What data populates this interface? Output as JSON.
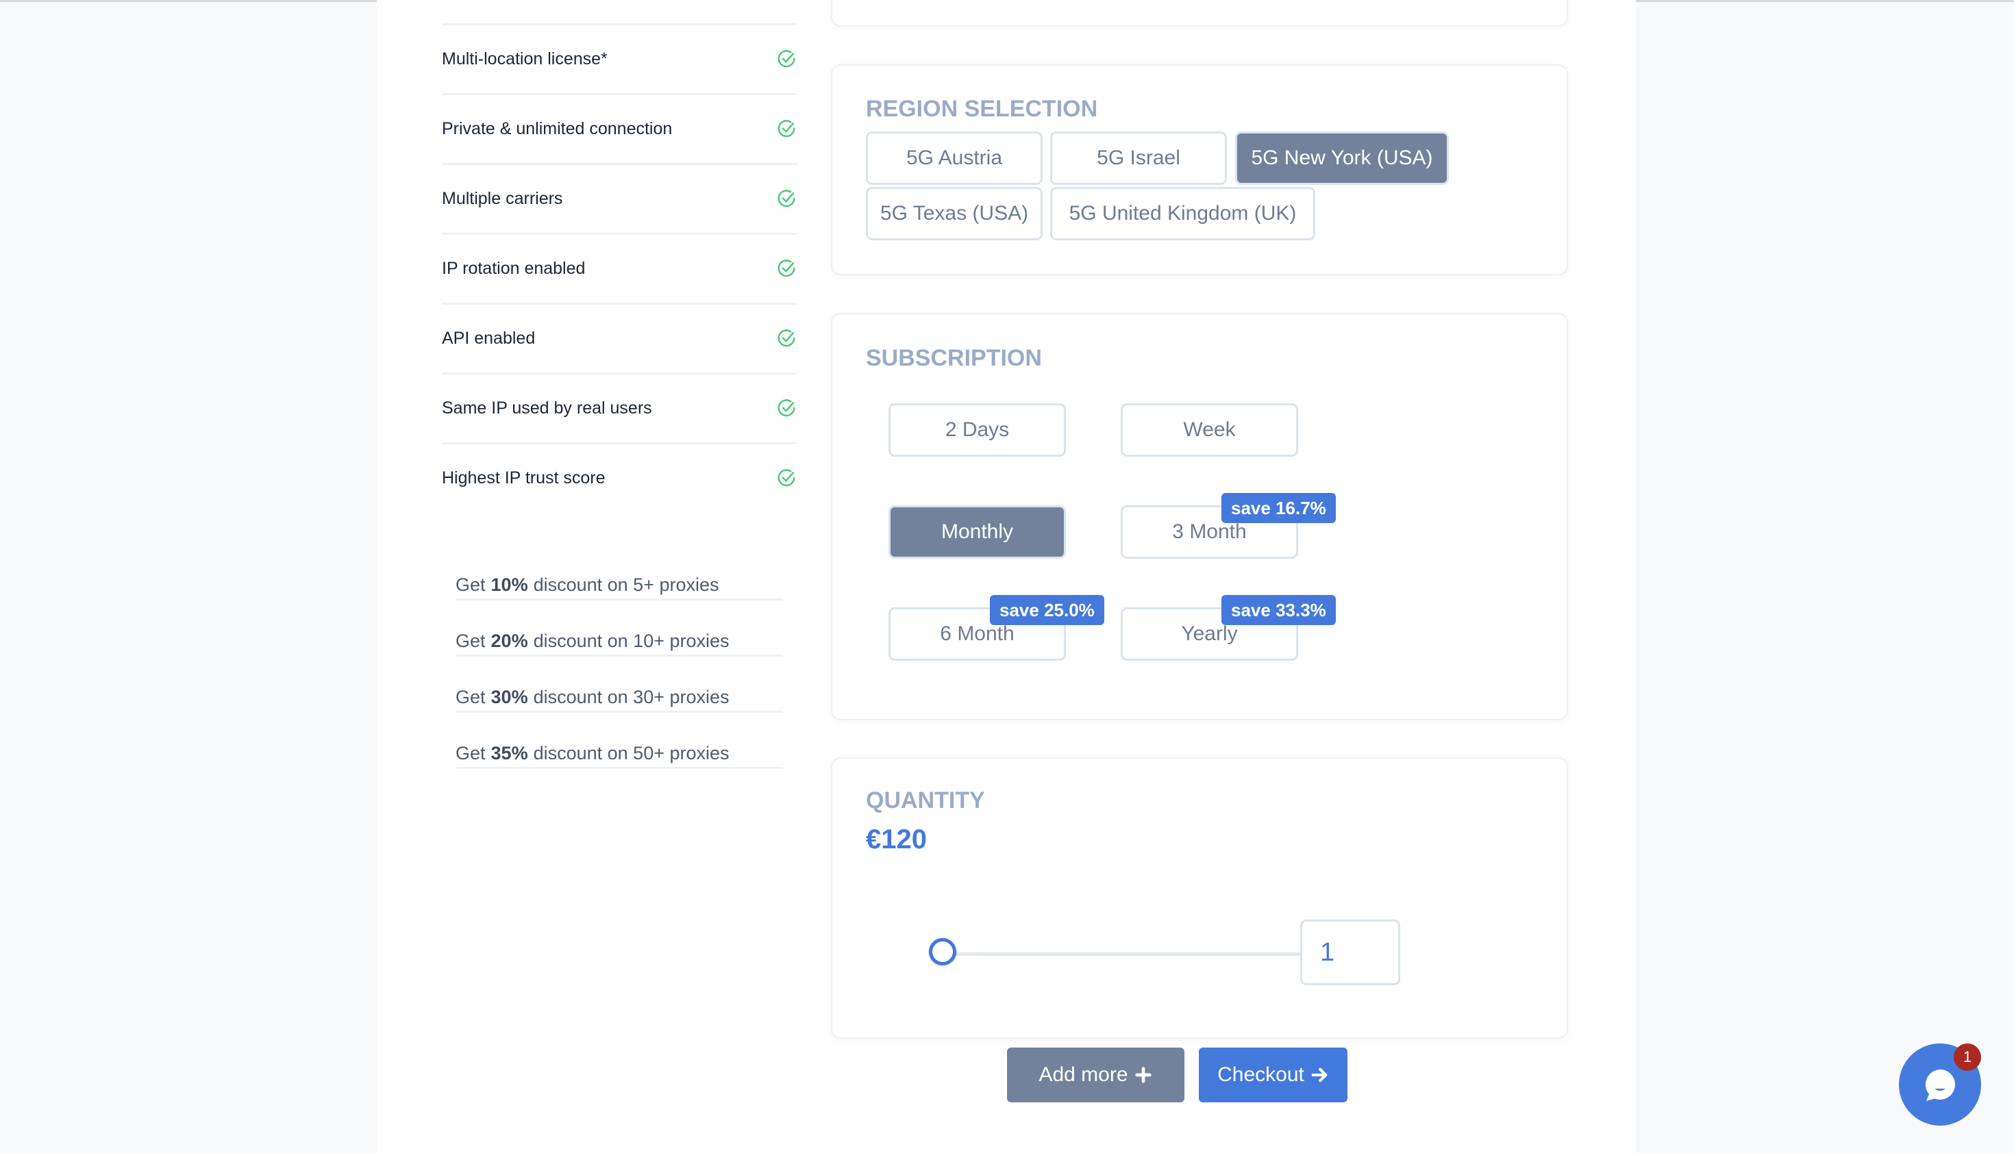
{
  "features": [
    {
      "label": "Multi-location license*",
      "icon": "check-circle-icon"
    },
    {
      "label": "Private & unlimited connection",
      "icon": "check-circle-icon"
    },
    {
      "label": "Multiple carriers",
      "icon": "check-circle-icon"
    },
    {
      "label": "IP rotation enabled",
      "icon": "check-circle-icon"
    },
    {
      "label": "API enabled",
      "icon": "check-circle-icon"
    },
    {
      "label": "Same IP used by real users",
      "icon": "check-circle-icon"
    },
    {
      "label": "Highest IP trust score",
      "icon": "check-circle-icon"
    }
  ],
  "discounts": [
    {
      "prefix": "Get",
      "percent": "10%",
      "suffix": "discount on 5+ proxies"
    },
    {
      "prefix": "Get",
      "percent": "20%",
      "suffix": "discount on 10+ proxies"
    },
    {
      "prefix": "Get",
      "percent": "30%",
      "suffix": "discount on 30+ proxies"
    },
    {
      "prefix": "Get",
      "percent": "35%",
      "suffix": "discount on 50+ proxies"
    }
  ],
  "region": {
    "title": "REGION SELECTION",
    "options": [
      {
        "label": "5G Austria",
        "selected": false
      },
      {
        "label": "5G Israel",
        "selected": false
      },
      {
        "label": "5G New York (USA)",
        "selected": true
      },
      {
        "label": "5G Texas (USA)",
        "selected": false
      },
      {
        "label": "5G United Kingdom (UK)",
        "selected": false
      }
    ]
  },
  "subscription": {
    "title": "SUBSCRIPTION",
    "options": [
      {
        "label": "2 Days",
        "selected": false,
        "badge": null
      },
      {
        "label": "Week",
        "selected": false,
        "badge": null
      },
      {
        "label": "Monthly",
        "selected": true,
        "badge": null
      },
      {
        "label": "3 Month",
        "selected": false,
        "badge": "save 16.7%"
      },
      {
        "label": "6 Month",
        "selected": false,
        "badge": "save 25.0%"
      },
      {
        "label": "Yearly",
        "selected": false,
        "badge": "save 33.3%"
      }
    ]
  },
  "quantity": {
    "title": "QUANTITY",
    "price": "€120",
    "value": "1",
    "slider_value": 1
  },
  "actions": {
    "add_more_label": "Add more",
    "add_more_icon": "plus-icon",
    "checkout_label": "Checkout",
    "checkout_icon": "arrow-right-icon"
  },
  "chat": {
    "icon": "chat-bubble-icon",
    "unread_count": "1"
  },
  "colors": {
    "accent": "#4479dc",
    "selected": "#72829c",
    "check": "#4cc97a",
    "badge_alert": "#aa2a22"
  }
}
